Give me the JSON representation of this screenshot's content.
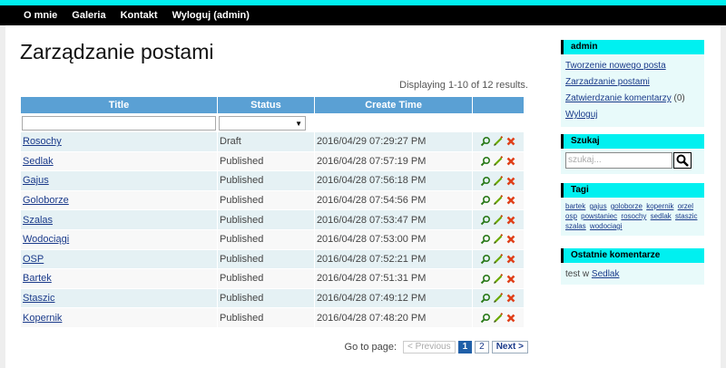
{
  "nav": {
    "items": [
      "O mnie",
      "Galeria",
      "Kontakt",
      "Wyloguj (admin)"
    ]
  },
  "main": {
    "title": "Zarządzanie postami",
    "summary": "Displaying 1-10 of 12 results.",
    "columns": [
      "Title",
      "Status",
      "Create Time"
    ],
    "rows": [
      {
        "title": "Rosochy",
        "status": "Draft",
        "time": "2016/04/29 07:29:27 PM"
      },
      {
        "title": "Sedlak",
        "status": "Published",
        "time": "2016/04/28 07:57:19 PM"
      },
      {
        "title": "Gajus",
        "status": "Published",
        "time": "2016/04/28 07:56:18 PM"
      },
      {
        "title": "Goloborze",
        "status": "Published",
        "time": "2016/04/28 07:54:56 PM"
      },
      {
        "title": "Szalas",
        "status": "Published",
        "time": "2016/04/28 07:53:47 PM"
      },
      {
        "title": "Wodociągi",
        "status": "Published",
        "time": "2016/04/28 07:53:00 PM"
      },
      {
        "title": "OSP",
        "status": "Published",
        "time": "2016/04/28 07:52:21 PM"
      },
      {
        "title": "Bartek",
        "status": "Published",
        "time": "2016/04/28 07:51:31 PM"
      },
      {
        "title": "Staszic",
        "status": "Published",
        "time": "2016/04/28 07:49:12 PM"
      },
      {
        "title": "Kopernik",
        "status": "Published",
        "time": "2016/04/28 07:48:20 PM"
      }
    ],
    "pager": {
      "label": "Go to page:",
      "prev": "< Previous",
      "pages": [
        "1",
        "2"
      ],
      "current": "1",
      "next": "Next >"
    }
  },
  "sidebar": {
    "admin": {
      "title": "admin",
      "links": [
        "Tworzenie nowego posta",
        "Zarzadzanie postami",
        "Zatwierdzanie komentarzy",
        "Wyloguj"
      ],
      "pending_count": "(0)"
    },
    "search": {
      "title": "Szukaj",
      "placeholder": "szukaj..."
    },
    "tags": {
      "title": "Tagi",
      "items": [
        "bartek",
        "gajus",
        "goloborze",
        "kopernik",
        "orzel",
        "osp",
        "powstaniec",
        "rosochy",
        "sedlak",
        "staszic",
        "szalas",
        "wodociagi"
      ]
    },
    "comments": {
      "title": "Ostatnie komentarze",
      "prefix": "test w",
      "link": "Sedlak"
    }
  },
  "colors": {
    "accent": "#00f0f0",
    "header": "#5aa0d4",
    "row_odd": "#e5f1f4",
    "link": "#1a3a8a"
  }
}
